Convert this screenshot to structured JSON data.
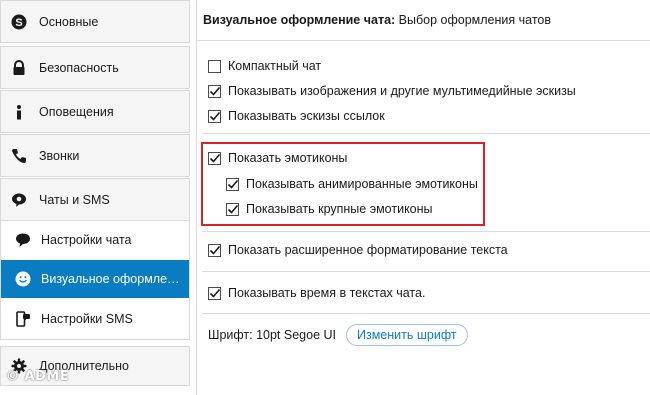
{
  "sidebar": {
    "items": [
      {
        "label": "Основные",
        "icon": "skype-icon"
      },
      {
        "label": "Безопасность",
        "icon": "lock-icon"
      },
      {
        "label": "Оповещения",
        "icon": "info-icon"
      },
      {
        "label": "Звонки",
        "icon": "phone-icon"
      },
      {
        "label": "Чаты и SMS",
        "icon": "chat-icon"
      }
    ],
    "subitems": [
      {
        "label": "Настройки чата",
        "icon": "speech-bubble-icon"
      },
      {
        "label": "Визуальное оформление чата",
        "icon": "smiley-icon",
        "active": true
      },
      {
        "label": "Настройки SMS",
        "icon": "mobile-sms-icon"
      }
    ],
    "advanced": {
      "label": "Дополнительно",
      "icon": "gear-icon"
    }
  },
  "header": {
    "title_bold": "Визуальное оформление чата:",
    "title_rest": " Выбор оформления чатов"
  },
  "options": {
    "compact": {
      "label": "Компактный чат",
      "checked": false
    },
    "thumbnails": {
      "label": "Показывать изображения и другие мультимедийные эскизы",
      "checked": true
    },
    "link_previews": {
      "label": "Показывать эскизы ссылок",
      "checked": true
    },
    "emoticons": {
      "label": "Показать эмотиконы",
      "checked": true
    },
    "animated": {
      "label": "Показывать анимированные эмотиконы",
      "checked": true
    },
    "large": {
      "label": "Показывать крупные эмотиконы",
      "checked": true
    },
    "formatting": {
      "label": "Показать расширенное форматирование текста",
      "checked": true
    },
    "time": {
      "label": "Показывать время в текстах чата.",
      "checked": true
    }
  },
  "font": {
    "label": "Шрифт: 10pt Segoe UI",
    "button": "Изменить шрифт"
  },
  "watermark": "© ADME",
  "colors": {
    "accent": "#0a7dc2",
    "highlight_border": "#d9222b"
  }
}
